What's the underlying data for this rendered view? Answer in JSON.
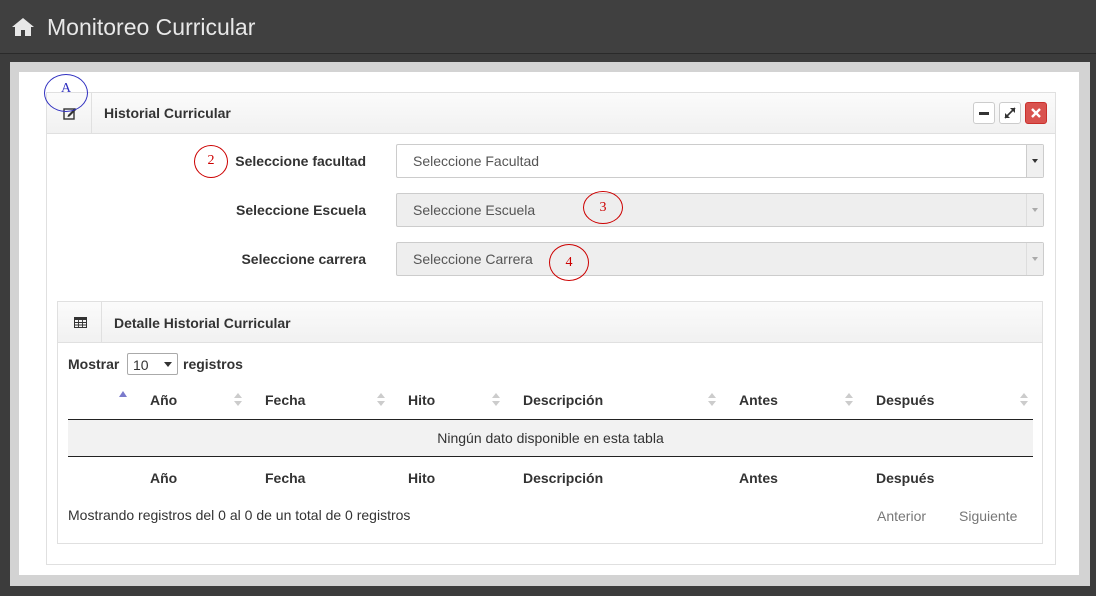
{
  "app": {
    "title": "Monitoreo Curricular"
  },
  "panel": {
    "title": "Historial Curricular"
  },
  "filters": {
    "facultad": {
      "label": "Seleccione facultad",
      "value": "Seleccione Facultad"
    },
    "escuela": {
      "label": "Seleccione Escuela",
      "value": "Seleccione Escuela"
    },
    "carrera": {
      "label": "Seleccione carrera",
      "value": "Seleccione Carrera"
    }
  },
  "annotations": {
    "a": "A",
    "n2": "2",
    "n3": "3",
    "n4": "4"
  },
  "detail": {
    "title": "Detalle Historial Curricular",
    "length_prefix": "Mostrar",
    "length_value": "10",
    "length_suffix": "registros",
    "columns": [
      "Año",
      "Fecha",
      "Hito",
      "Descripción",
      "Antes",
      "Después"
    ],
    "empty": "Ningún dato disponible en esta tabla",
    "info": "Mostrando registros del 0 al 0 de un total de 0 registros",
    "prev": "Anterior",
    "next": "Siguiente"
  },
  "colors": {
    "close": "#d9534f",
    "annot_red": "#cc0000",
    "annot_blue": "#3030c0",
    "sort_active": "#7a7acc"
  }
}
